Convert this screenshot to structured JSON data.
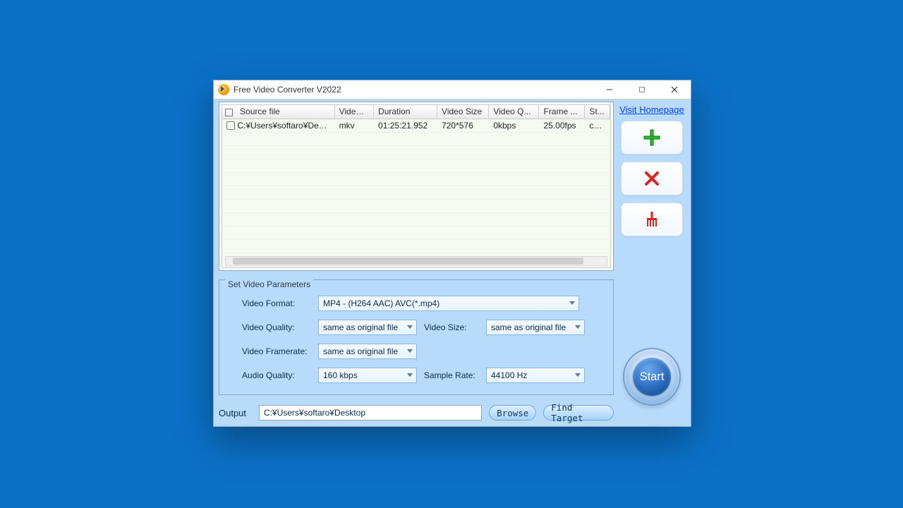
{
  "window": {
    "title": "Free Video Converter V2022"
  },
  "link": {
    "homepage": "Visit Homepage"
  },
  "grid": {
    "headers": [
      "Source file",
      "Video ...",
      "Duration",
      "Video Size",
      "Video Q...",
      "Frame ...",
      "St..."
    ],
    "rows": [
      {
        "source": "C:¥Users¥softaro¥Des...",
        "format": "mkv",
        "duration": "01:25:21.952",
        "size": "720*576",
        "quality": "0kbps",
        "fps": "25.00fps",
        "status": "co..."
      }
    ]
  },
  "params": {
    "legend": "Set Video Parameters",
    "labels": {
      "format": "Video Format:",
      "vquality": "Video Quality:",
      "vsize": "Video Size:",
      "vfps": "Video Framerate:",
      "aquality": "Audio Quality:",
      "srate": "Sample Rate:"
    },
    "values": {
      "format": "MP4 - (H264 AAC) AVC(*.mp4)",
      "vquality": "same as original file",
      "vsize": "same as original file",
      "vfps": "same as original file",
      "aquality": "160 kbps",
      "srate": "44100 Hz"
    }
  },
  "output": {
    "label": "Output",
    "path": "C:¥Users¥softaro¥Desktop",
    "browse": "Browse",
    "find": "Find Target"
  },
  "start": {
    "label": "Start"
  }
}
